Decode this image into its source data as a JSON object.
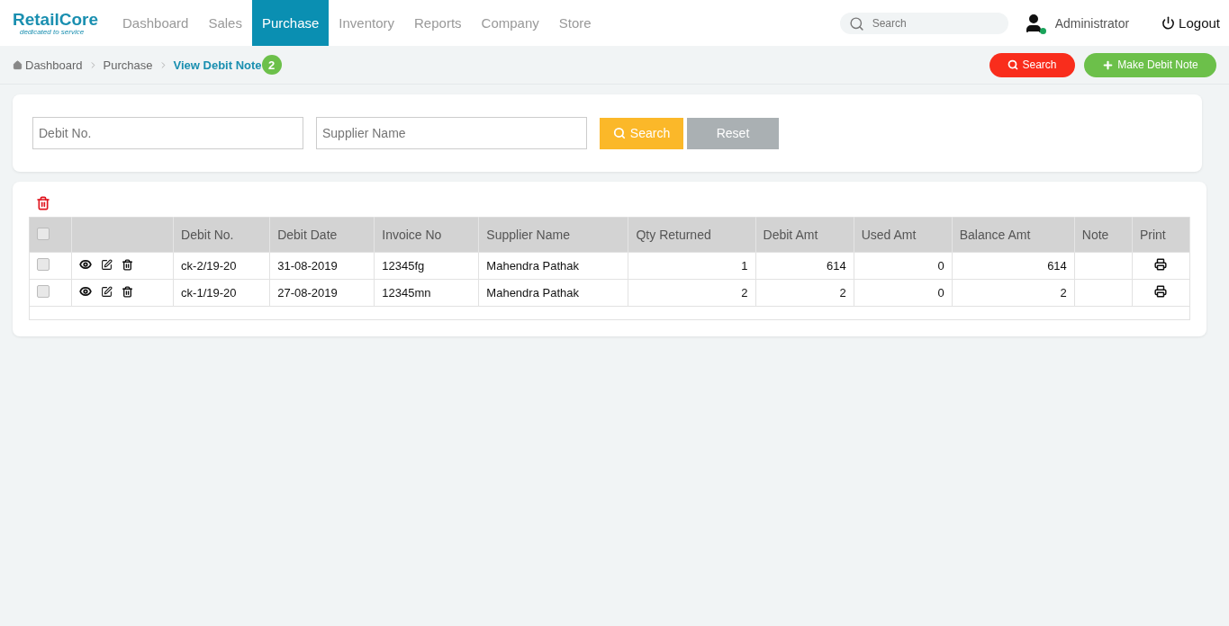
{
  "brand": {
    "name": "RetailCore",
    "tagline": "dedicated to service"
  },
  "nav": [
    {
      "label": "Dashboard",
      "selected": false
    },
    {
      "label": "Sales",
      "selected": false
    },
    {
      "label": "Purchase",
      "selected": true
    },
    {
      "label": "Inventory",
      "selected": false
    },
    {
      "label": "Reports",
      "selected": false
    },
    {
      "label": "Company",
      "selected": false
    },
    {
      "label": "Store",
      "selected": false
    }
  ],
  "top_search": {
    "placeholder": "Search"
  },
  "user": {
    "name": "Administrator",
    "online": true
  },
  "logout": "Logout",
  "breadcrumb": [
    {
      "label": "Dashboard"
    },
    {
      "label": "Purchase"
    },
    {
      "label": "View Debit Note"
    }
  ],
  "count_badge": "2",
  "actions": [
    {
      "kind": "search",
      "label": "Search"
    },
    {
      "kind": "add",
      "label": "Make Debit Note"
    }
  ],
  "filters": {
    "fields": [
      {
        "placeholder": "Debit No."
      },
      {
        "placeholder": "Supplier Name"
      }
    ],
    "search": "Search",
    "reset": "Reset"
  },
  "table": {
    "all_checked": false,
    "columns": [
      "Debit No.",
      "Debit Date",
      "Invoice No",
      "Supplier Name",
      "Qty Returned",
      "Debit Amt",
      "Used Amt",
      "Balance Amt",
      "Note",
      "Print"
    ],
    "rows": [
      {
        "checked": false,
        "cells": [
          "ck-2/19-20",
          "31-08-2019",
          "12345fg",
          "Mahendra Pathak",
          "1",
          "614",
          "0",
          "614"
        ]
      },
      {
        "checked": false,
        "cells": [
          "ck-1/19-20",
          "27-08-2019",
          "12345mn",
          "Mahendra Pathak",
          "2",
          "2",
          "0",
          "2"
        ]
      }
    ]
  }
}
